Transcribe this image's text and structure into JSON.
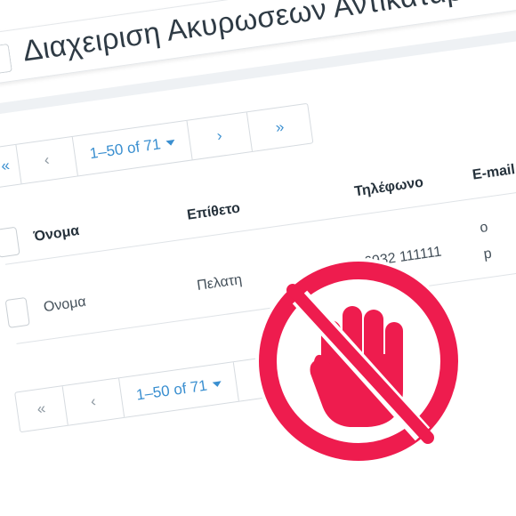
{
  "header": {
    "title": "Διαχειριση Ακυρωσεων Αντικαταβολων"
  },
  "pager_top": {
    "first_label": "«",
    "prev_label": "‹",
    "range_label": "1–50 of 71",
    "next_label": "›",
    "last_label": "»"
  },
  "table": {
    "headers": [
      "Όνομα",
      "Επίθετο",
      "Τηλέφωνο",
      "E-mail"
    ],
    "rows": [
      [
        "Ονομα",
        "Πελατη",
        "6932 111111",
        "o"
      ]
    ],
    "overflow_text": "p"
  },
  "pager_bottom": {
    "first_label": "«",
    "prev_label": "‹",
    "range_label": "1–50 of 71",
    "next_label": "›"
  },
  "overlay": {
    "icon": "no-hand-stop-icon",
    "color": "#ee1c4e"
  },
  "colors": {
    "accent": "#3a8fd0",
    "topbar": "#1f7fc4"
  }
}
